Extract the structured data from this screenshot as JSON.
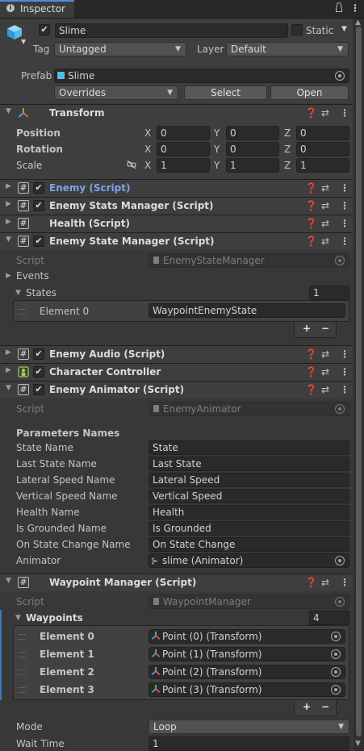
{
  "tab": {
    "title": "Inspector"
  },
  "object": {
    "active": true,
    "name": "Slime",
    "static_label": "Static",
    "static": false,
    "tag_label": "Tag",
    "tag_value": "Untagged",
    "layer_label": "Layer",
    "layer_value": "Default"
  },
  "prefab": {
    "label": "Prefab",
    "value": "Slime",
    "overrides": "Overrides",
    "select": "Select",
    "open": "Open"
  },
  "transform": {
    "title": "Transform",
    "position_label": "Position",
    "rotation_label": "Rotation",
    "scale_label": "Scale",
    "position": {
      "x": "0",
      "y": "0",
      "z": "0"
    },
    "rotation": {
      "x": "0",
      "y": "0",
      "z": "0"
    },
    "scale": {
      "x": "1",
      "y": "1",
      "z": "1"
    },
    "axis": {
      "x": "X",
      "y": "Y",
      "z": "Z"
    }
  },
  "components": {
    "enemy": "Enemy (Script)",
    "enemy_stats": "Enemy Stats Manager (Script)",
    "health": "Health (Script)",
    "enemy_state": "Enemy State Manager (Script)",
    "enemy_audio": "Enemy Audio (Script)",
    "character_controller": "Character Controller",
    "enemy_animator": "Enemy Animator (Script)",
    "waypoint_manager": "Waypoint Manager (Script)"
  },
  "state_manager": {
    "script_label": "Script",
    "script_value": "EnemyStateManager",
    "events_label": "Events",
    "states_label": "States",
    "states_count": "1",
    "element_label": "Element 0",
    "element_value": "WaypointEnemyState"
  },
  "list_buttons": {
    "plus": "+",
    "minus": "−"
  },
  "animator": {
    "script_label": "Script",
    "script_value": "EnemyAnimator",
    "section": "Parameters Names",
    "rows": [
      {
        "label": "State Name",
        "value": "State"
      },
      {
        "label": "Last State Name",
        "value": "Last State"
      },
      {
        "label": "Lateral Speed Name",
        "value": "Lateral Speed"
      },
      {
        "label": "Vertical Speed Name",
        "value": "Vertical Speed"
      },
      {
        "label": "Health Name",
        "value": "Health"
      },
      {
        "label": "Is Grounded Name",
        "value": "Is Grounded"
      },
      {
        "label": "On State Change Name",
        "value": "On State Change"
      }
    ],
    "animator_label": "Animator",
    "animator_value": "slime (Animator)"
  },
  "waypoints": {
    "script_label": "Script",
    "script_value": "WaypointManager",
    "list_label": "Waypoints",
    "count": "4",
    "elements": [
      {
        "label": "Element 0",
        "value": "Point (0) (Transform)"
      },
      {
        "label": "Element 1",
        "value": "Point (1) (Transform)"
      },
      {
        "label": "Element 2",
        "value": "Point (2) (Transform)"
      },
      {
        "label": "Element 3",
        "value": "Point (3) (Transform)"
      }
    ],
    "mode_label": "Mode",
    "mode_value": "Loop",
    "wait_label": "Wait Time",
    "wait_value": "1"
  },
  "icons": {
    "lock": "lock-icon",
    "menu": "kebab-icon",
    "help": "help-icon",
    "preset": "preset-icon"
  },
  "colors": {
    "selected_title": "#7aa5e8",
    "accent_bar": "#3a79bb"
  }
}
